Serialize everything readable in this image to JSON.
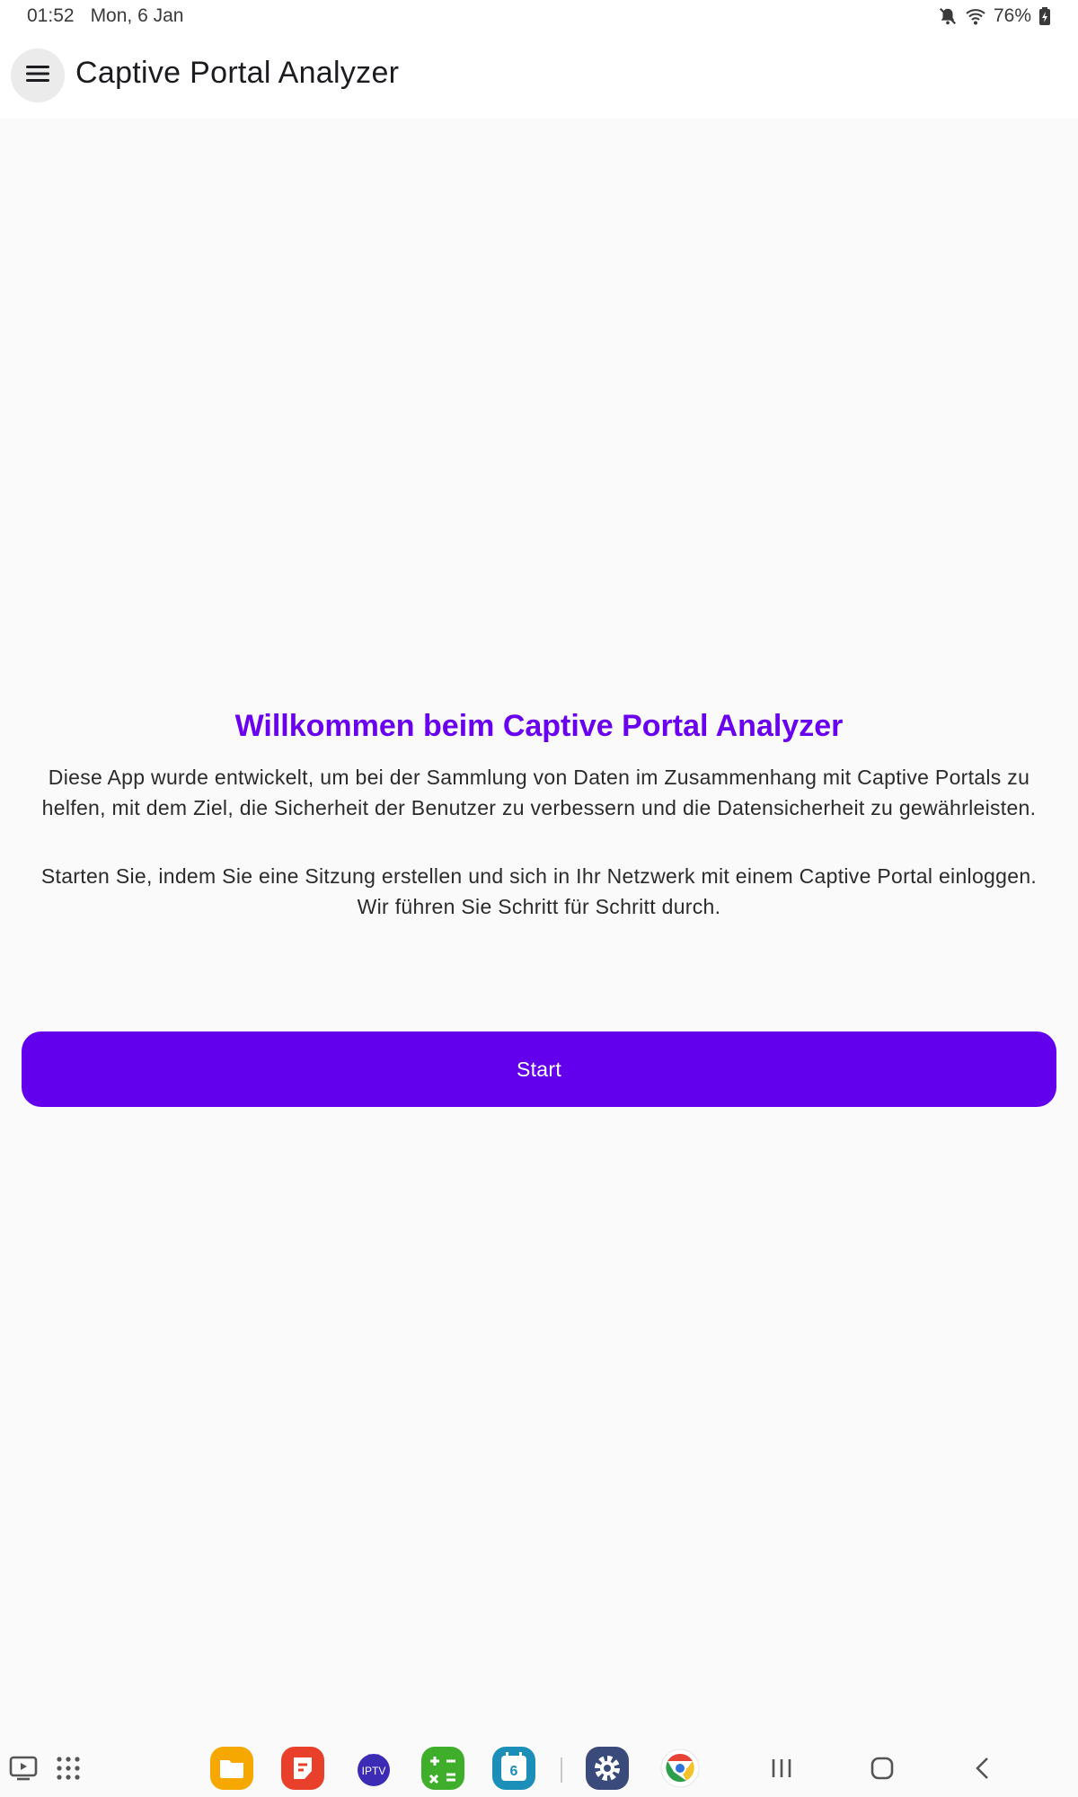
{
  "status_bar": {
    "time": "01:52",
    "date": "Mon, 6 Jan",
    "battery": "76%"
  },
  "app_bar": {
    "title": "Captive Portal Analyzer",
    "menu_icon": "hamburger-menu-icon"
  },
  "welcome": {
    "title": "Willkommen beim Captive Portal Analyzer",
    "description": "Diese App wurde entwickelt, um bei der Sammlung von Daten im Zusammenhang mit Captive Portals zu helfen, mit dem Ziel, die Sicherheit der Benutzer zu verbessern und die Datensicherheit zu gewährleisten.",
    "hint": "Starten Sie, indem Sie eine Sitzung erstellen und sich in Ihr Netzwerk mit einem Captive Portal einloggen. Wir führen Sie Schritt für Schritt durch.",
    "start_label": "Start"
  },
  "colors": {
    "accent": "#6200ee",
    "title": "#6a00f0",
    "background": "#fafafa"
  },
  "taskbar": {
    "calendar_day": "6",
    "apps": [
      "my-files-icon",
      "samsung-notes-icon",
      "iptv-icon",
      "calculator-icon",
      "calendar-icon",
      "settings-icon",
      "chrome-icon"
    ],
    "nav": [
      "recents-icon",
      "home-icon",
      "back-icon"
    ]
  }
}
